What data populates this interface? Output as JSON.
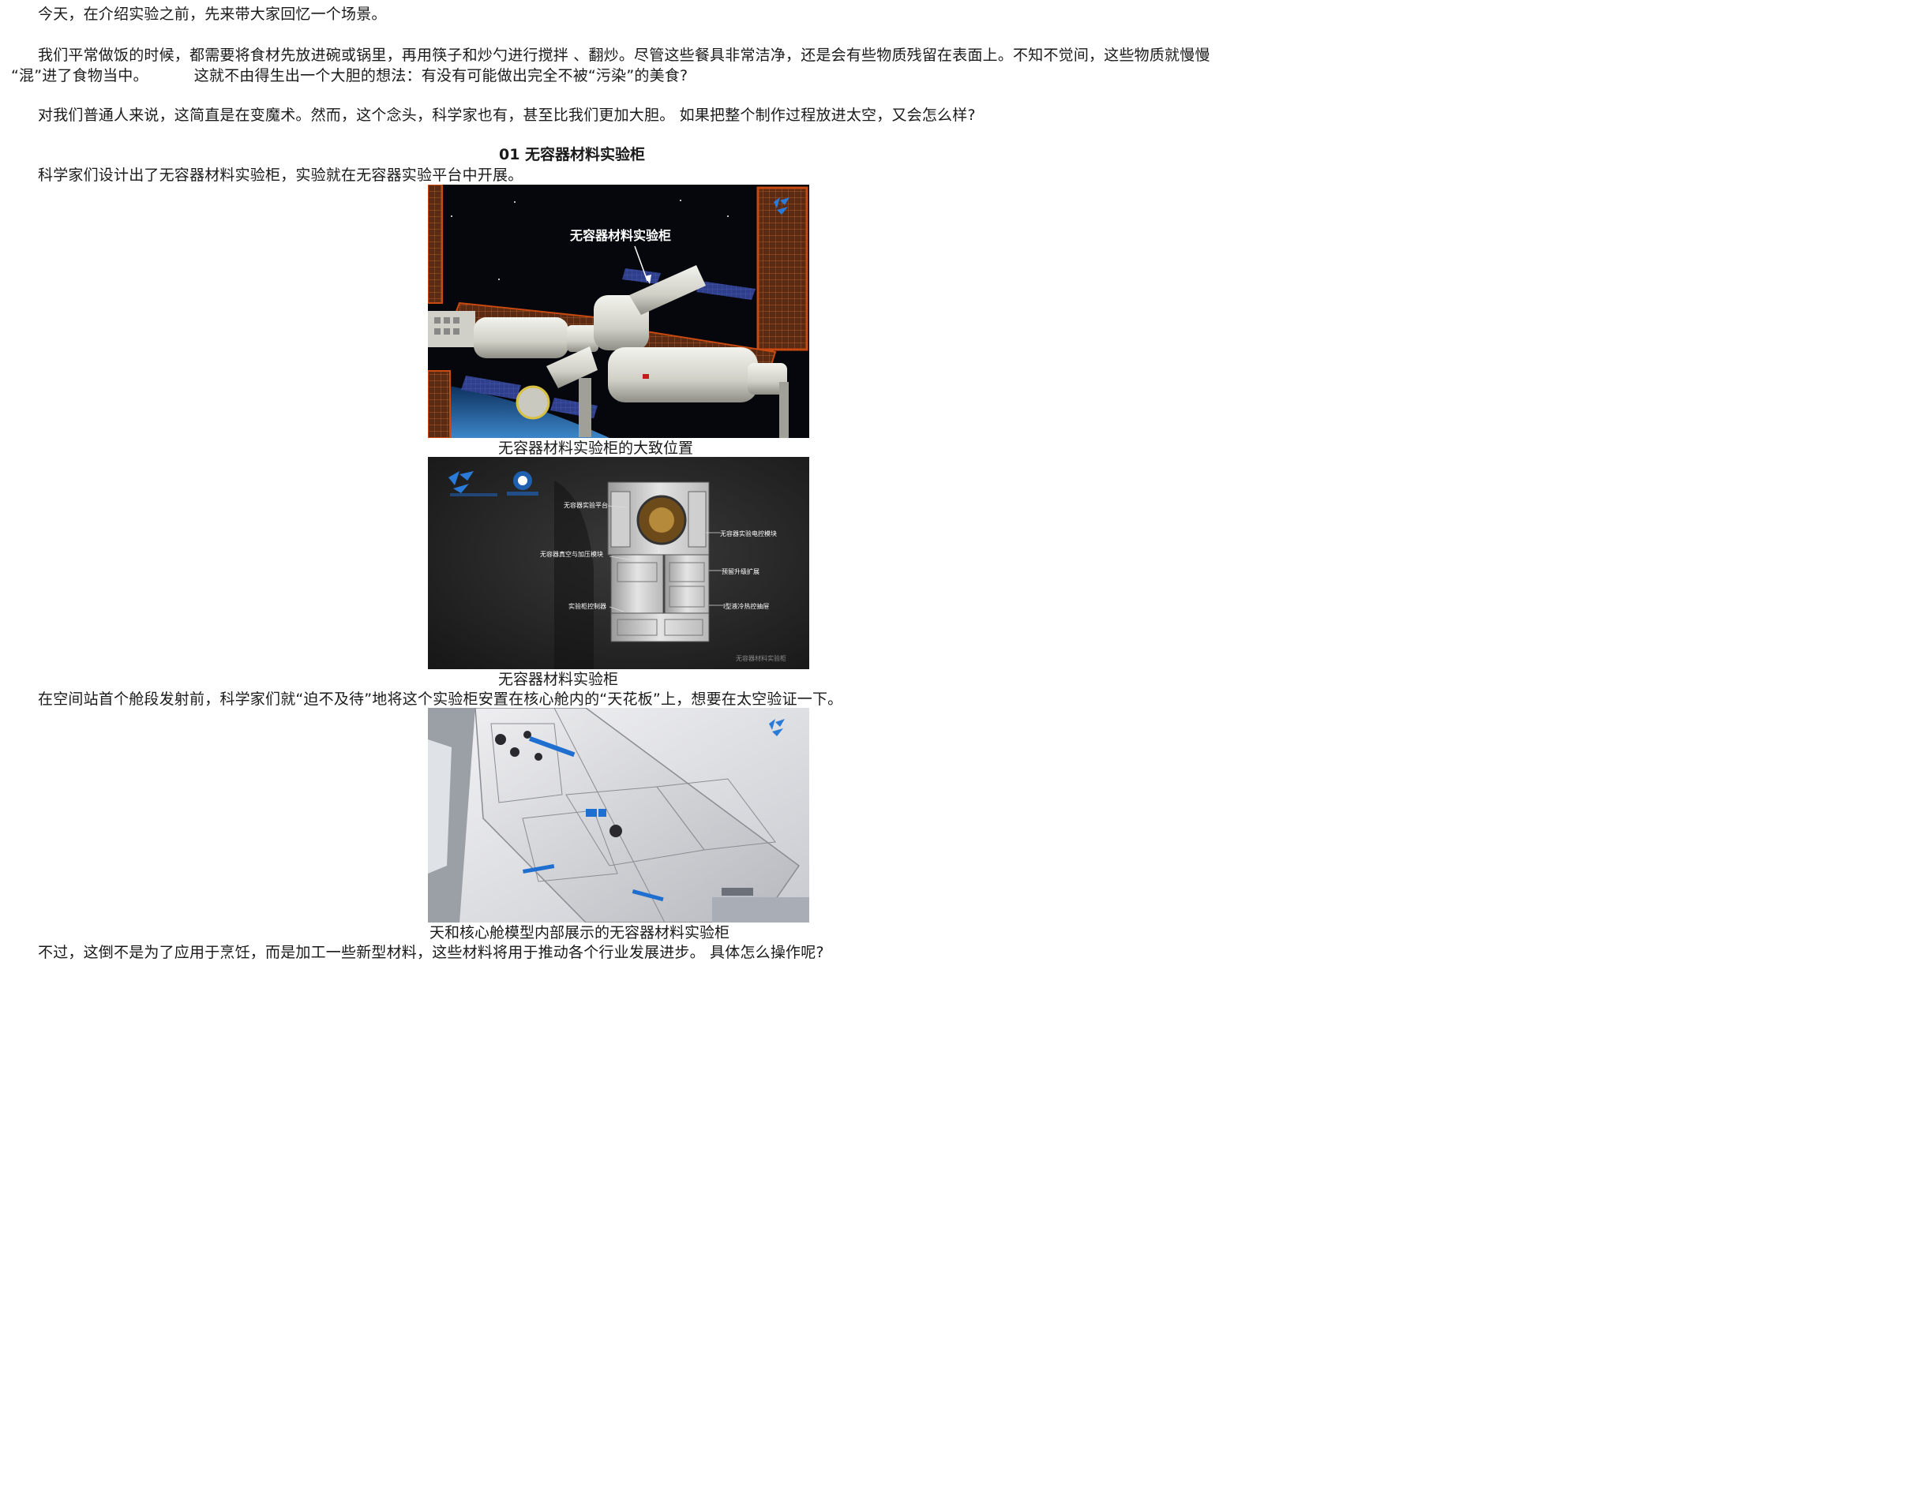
{
  "paragraphs": {
    "p1": "今天，在介绍实验之前，先来带大家回忆一个场景。",
    "p2_line1": "我们平常做饭的时候，都需要将食材先放进碗或锅里，再用筷子和炒勺进行搅拌 、翻炒。尽管这些餐具非常洁净，还是会有些物质残留在表面上。不知不觉间，这些物质就慢慢",
    "p2_line2a": "“混”进了食物当中。",
    "p2_line2b": "这就不由得生出一个大胆的想法：有没有可能做出完全不被“污染”的美食?",
    "p3": "对我们普通人来说，这简直是在变魔术。然而，这个念头，科学家也有，甚至比我们更加大胆。 如果把整个制作过程放进太空，又会怎么样?",
    "p4": "科学家们设计出了无容器材料实验柜，实验就在无容器实验平台中开展。",
    "p5": "在空间站首个舱段发射前，科学家们就“迫不及待”地将这个实验柜安置在核心舱内的“天花板”上，想要在太空验证一下。",
    "p6": "不过，这倒不是为了应用于烹饪，而是加工一些新型材料，这些材料将用于推动各个行业发展进步。 具体怎么操作呢?"
  },
  "section_heading": "01 无容器材料实验柜",
  "figures": {
    "fig1": {
      "caption": "无容器材料实验柜的大致位置",
      "label": "无容器材料实验柜"
    },
    "fig2": {
      "caption": "无容器材料实验柜",
      "labels": {
        "platform": "无容器实验平台",
        "electric": "无容器实验电控模块",
        "vacuum": "无容器真空与加压模块",
        "reserve": "预留升级扩展",
        "controller": "实验柜控制器",
        "cooling": "I型液冷热控抽屉",
        "watermark": "无容器材料实验柜"
      }
    },
    "fig3": {
      "caption": "天和核心舱模型内部展示的无容器材料实验柜"
    }
  }
}
